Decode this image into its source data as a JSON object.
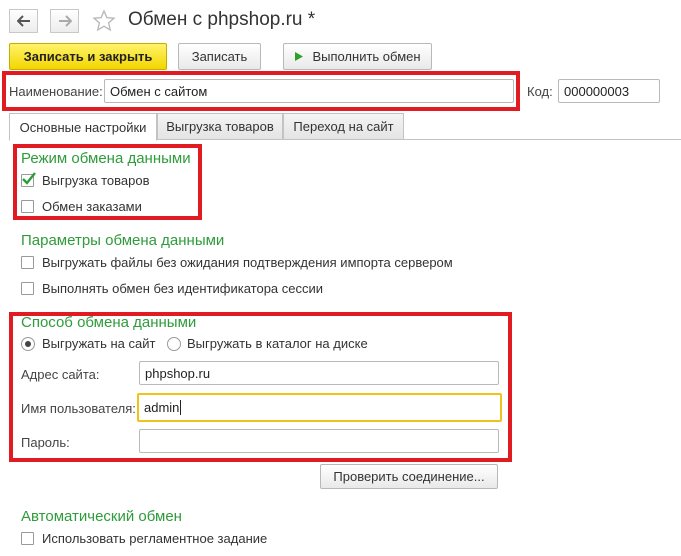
{
  "window": {
    "title": "Обмен с phpshop.ru *"
  },
  "toolbar": {
    "save_close_label": "Записать и закрыть",
    "save_label": "Записать",
    "run_exchange_label": "Выполнить обмен"
  },
  "header": {
    "name_label": "Наименование:",
    "name_value": "Обмен с сайтом",
    "code_label": "Код:",
    "code_value": "000000003"
  },
  "tabs": [
    {
      "label": "Основные настройки",
      "active": true
    },
    {
      "label": "Выгрузка товаров",
      "active": false
    },
    {
      "label": "Переход на сайт",
      "active": false
    }
  ],
  "mode_section": {
    "title": "Режим обмена данными",
    "items": [
      {
        "label": "Выгрузка товаров",
        "checked": true
      },
      {
        "label": "Обмен заказами",
        "checked": false
      }
    ]
  },
  "params_section": {
    "title": "Параметры обмена данными",
    "items": [
      {
        "label": "Выгружать файлы без ожидания подтверждения импорта сервером",
        "checked": false
      },
      {
        "label": "Выполнять обмен без идентификатора сессии",
        "checked": false
      }
    ]
  },
  "method_section": {
    "title": "Способ обмена данными",
    "radios": [
      {
        "label": "Выгружать на сайт",
        "selected": true
      },
      {
        "label": "Выгружать в каталог на диске",
        "selected": false
      }
    ],
    "site_label": "Адрес сайта:",
    "site_value": "phpshop.ru",
    "user_label": "Имя пользователя:",
    "user_value": "admin",
    "password_label": "Пароль:",
    "password_value": "",
    "check_button_label": "Проверить соединение..."
  },
  "auto_section": {
    "title": "Автоматический обмен",
    "items": [
      {
        "label": "Использовать регламентное задание",
        "checked": false
      }
    ]
  },
  "colors": {
    "accent_yellow": "#f3d600",
    "section_green": "#2e9c3a",
    "highlight_red": "#e01b22",
    "focus_yellow": "#f0c21c"
  }
}
